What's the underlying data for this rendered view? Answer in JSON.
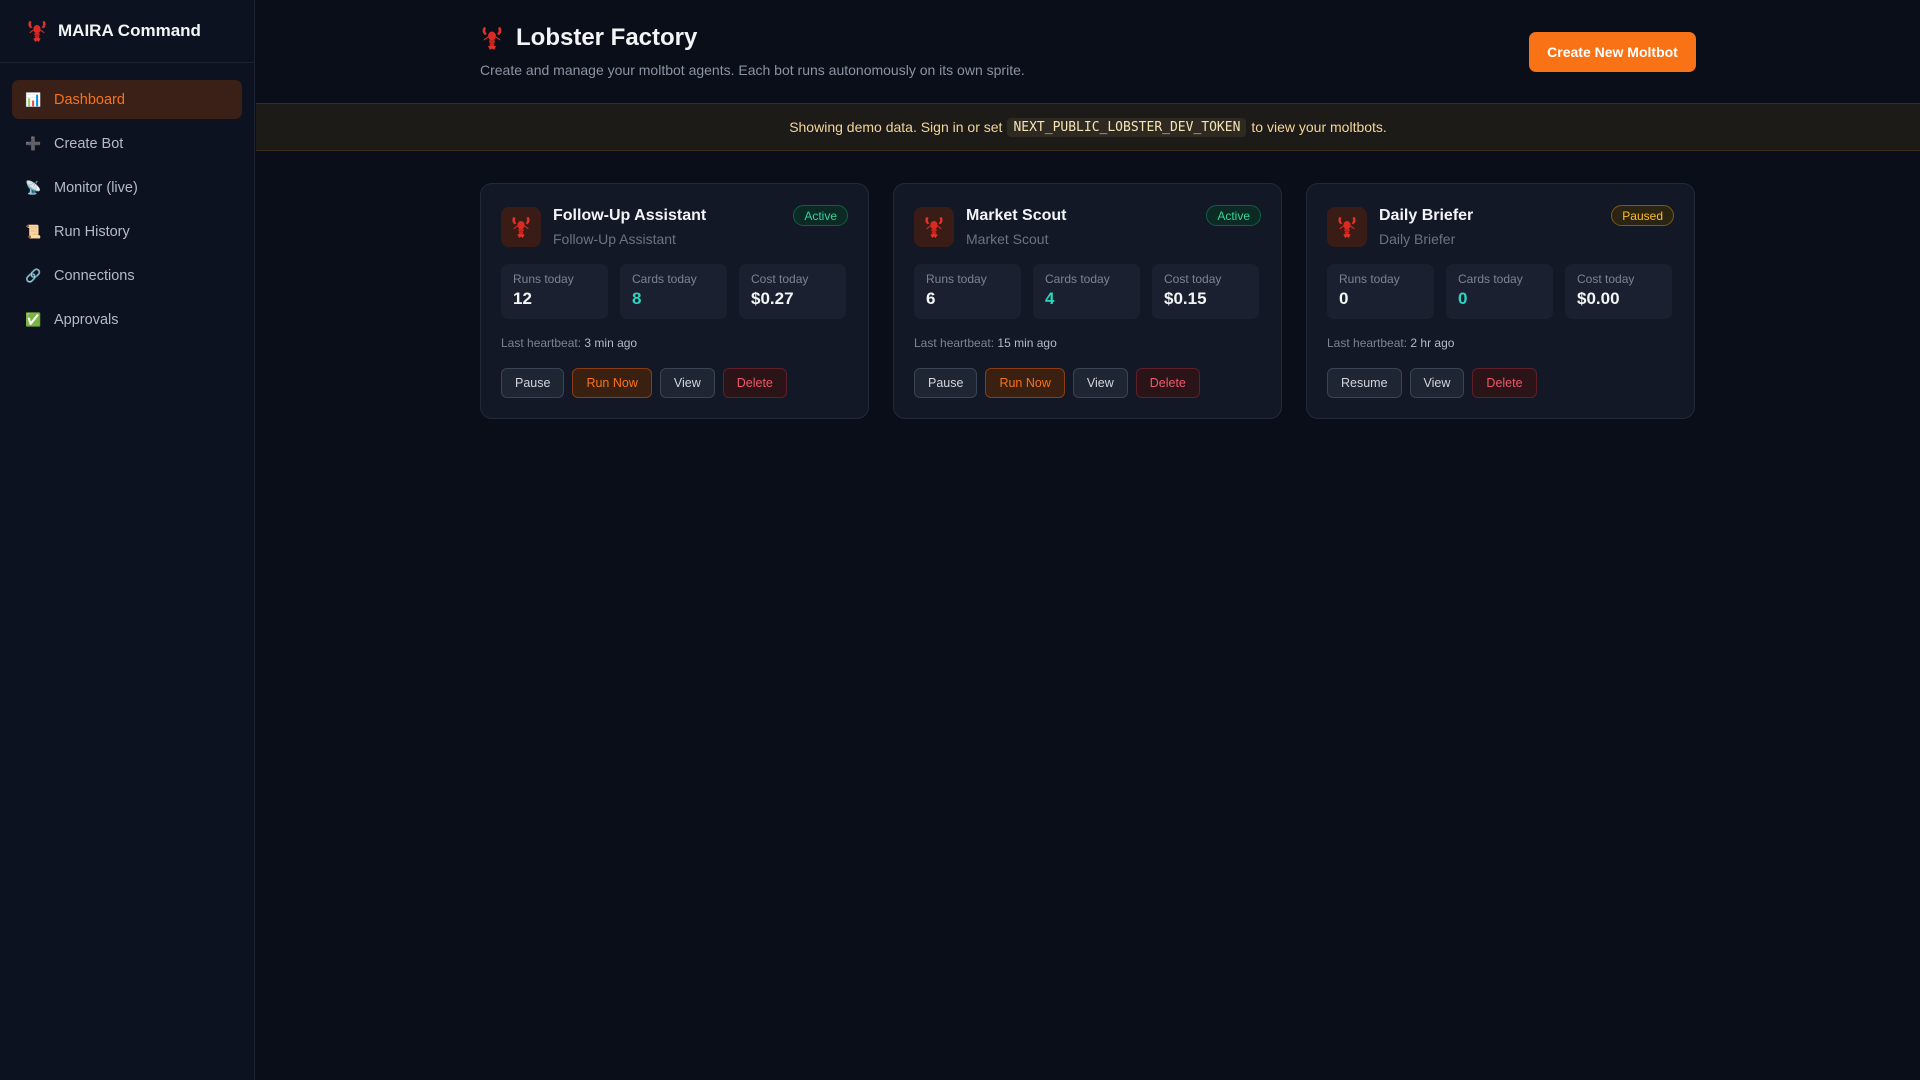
{
  "brand": {
    "name": "MAIRA Command"
  },
  "nav": [
    {
      "label": "Dashboard",
      "icon": "bar-chart-icon",
      "glyph": "📊",
      "active": true
    },
    {
      "label": "Create Bot",
      "icon": "plus-icon",
      "glyph": "➕",
      "active": false
    },
    {
      "label": "Monitor (live)",
      "icon": "satellite-icon",
      "glyph": "📡",
      "active": false
    },
    {
      "label": "Run History",
      "icon": "scroll-icon",
      "glyph": "📜",
      "active": false
    },
    {
      "label": "Connections",
      "icon": "link-icon",
      "glyph": "🔗",
      "active": false
    },
    {
      "label": "Approvals",
      "icon": "check-box-icon",
      "glyph": "✅",
      "active": false
    }
  ],
  "header": {
    "title": "Lobster Factory",
    "subtitle": "Create and manage your moltbot agents. Each bot runs autonomously on its own sprite.",
    "create_label": "Create New Moltbot"
  },
  "banner": {
    "before": "Showing demo data. Sign in or set",
    "code": "NEXT_PUBLIC_LOBSTER_DEV_TOKEN",
    "after": "to view your moltbots."
  },
  "labels": {
    "runs": "Runs today",
    "cards": "Cards today",
    "cost": "Cost today",
    "heartbeat": "Last heartbeat:"
  },
  "bots": [
    {
      "name": "Follow-Up Assistant",
      "subtitle": "Follow-Up Assistant",
      "status": "Active",
      "status_type": "active",
      "runs": "12",
      "cards": "8",
      "cost": "$0.27",
      "heartbeat": "3 min ago",
      "actions": [
        {
          "label": "Pause",
          "style": "default"
        },
        {
          "label": "Run Now",
          "style": "orange"
        },
        {
          "label": "View",
          "style": "default"
        },
        {
          "label": "Delete",
          "style": "red"
        }
      ]
    },
    {
      "name": "Market Scout",
      "subtitle": "Market Scout",
      "status": "Active",
      "status_type": "active",
      "runs": "6",
      "cards": "4",
      "cost": "$0.15",
      "heartbeat": "15 min ago",
      "actions": [
        {
          "label": "Pause",
          "style": "default"
        },
        {
          "label": "Run Now",
          "style": "orange"
        },
        {
          "label": "View",
          "style": "default"
        },
        {
          "label": "Delete",
          "style": "red"
        }
      ]
    },
    {
      "name": "Daily Briefer",
      "subtitle": "Daily Briefer",
      "status": "Paused",
      "status_type": "paused",
      "runs": "0",
      "cards": "0",
      "cost": "$0.00",
      "heartbeat": "2 hr ago",
      "actions": [
        {
          "label": "Resume",
          "style": "default"
        },
        {
          "label": "View",
          "style": "default"
        },
        {
          "label": "Delete",
          "style": "red"
        }
      ]
    }
  ],
  "colors": {
    "accent": "#f97316",
    "active": "#34d399",
    "paused": "#fbbf24",
    "teal": "#2dd4bf",
    "danger": "#f0566a"
  }
}
